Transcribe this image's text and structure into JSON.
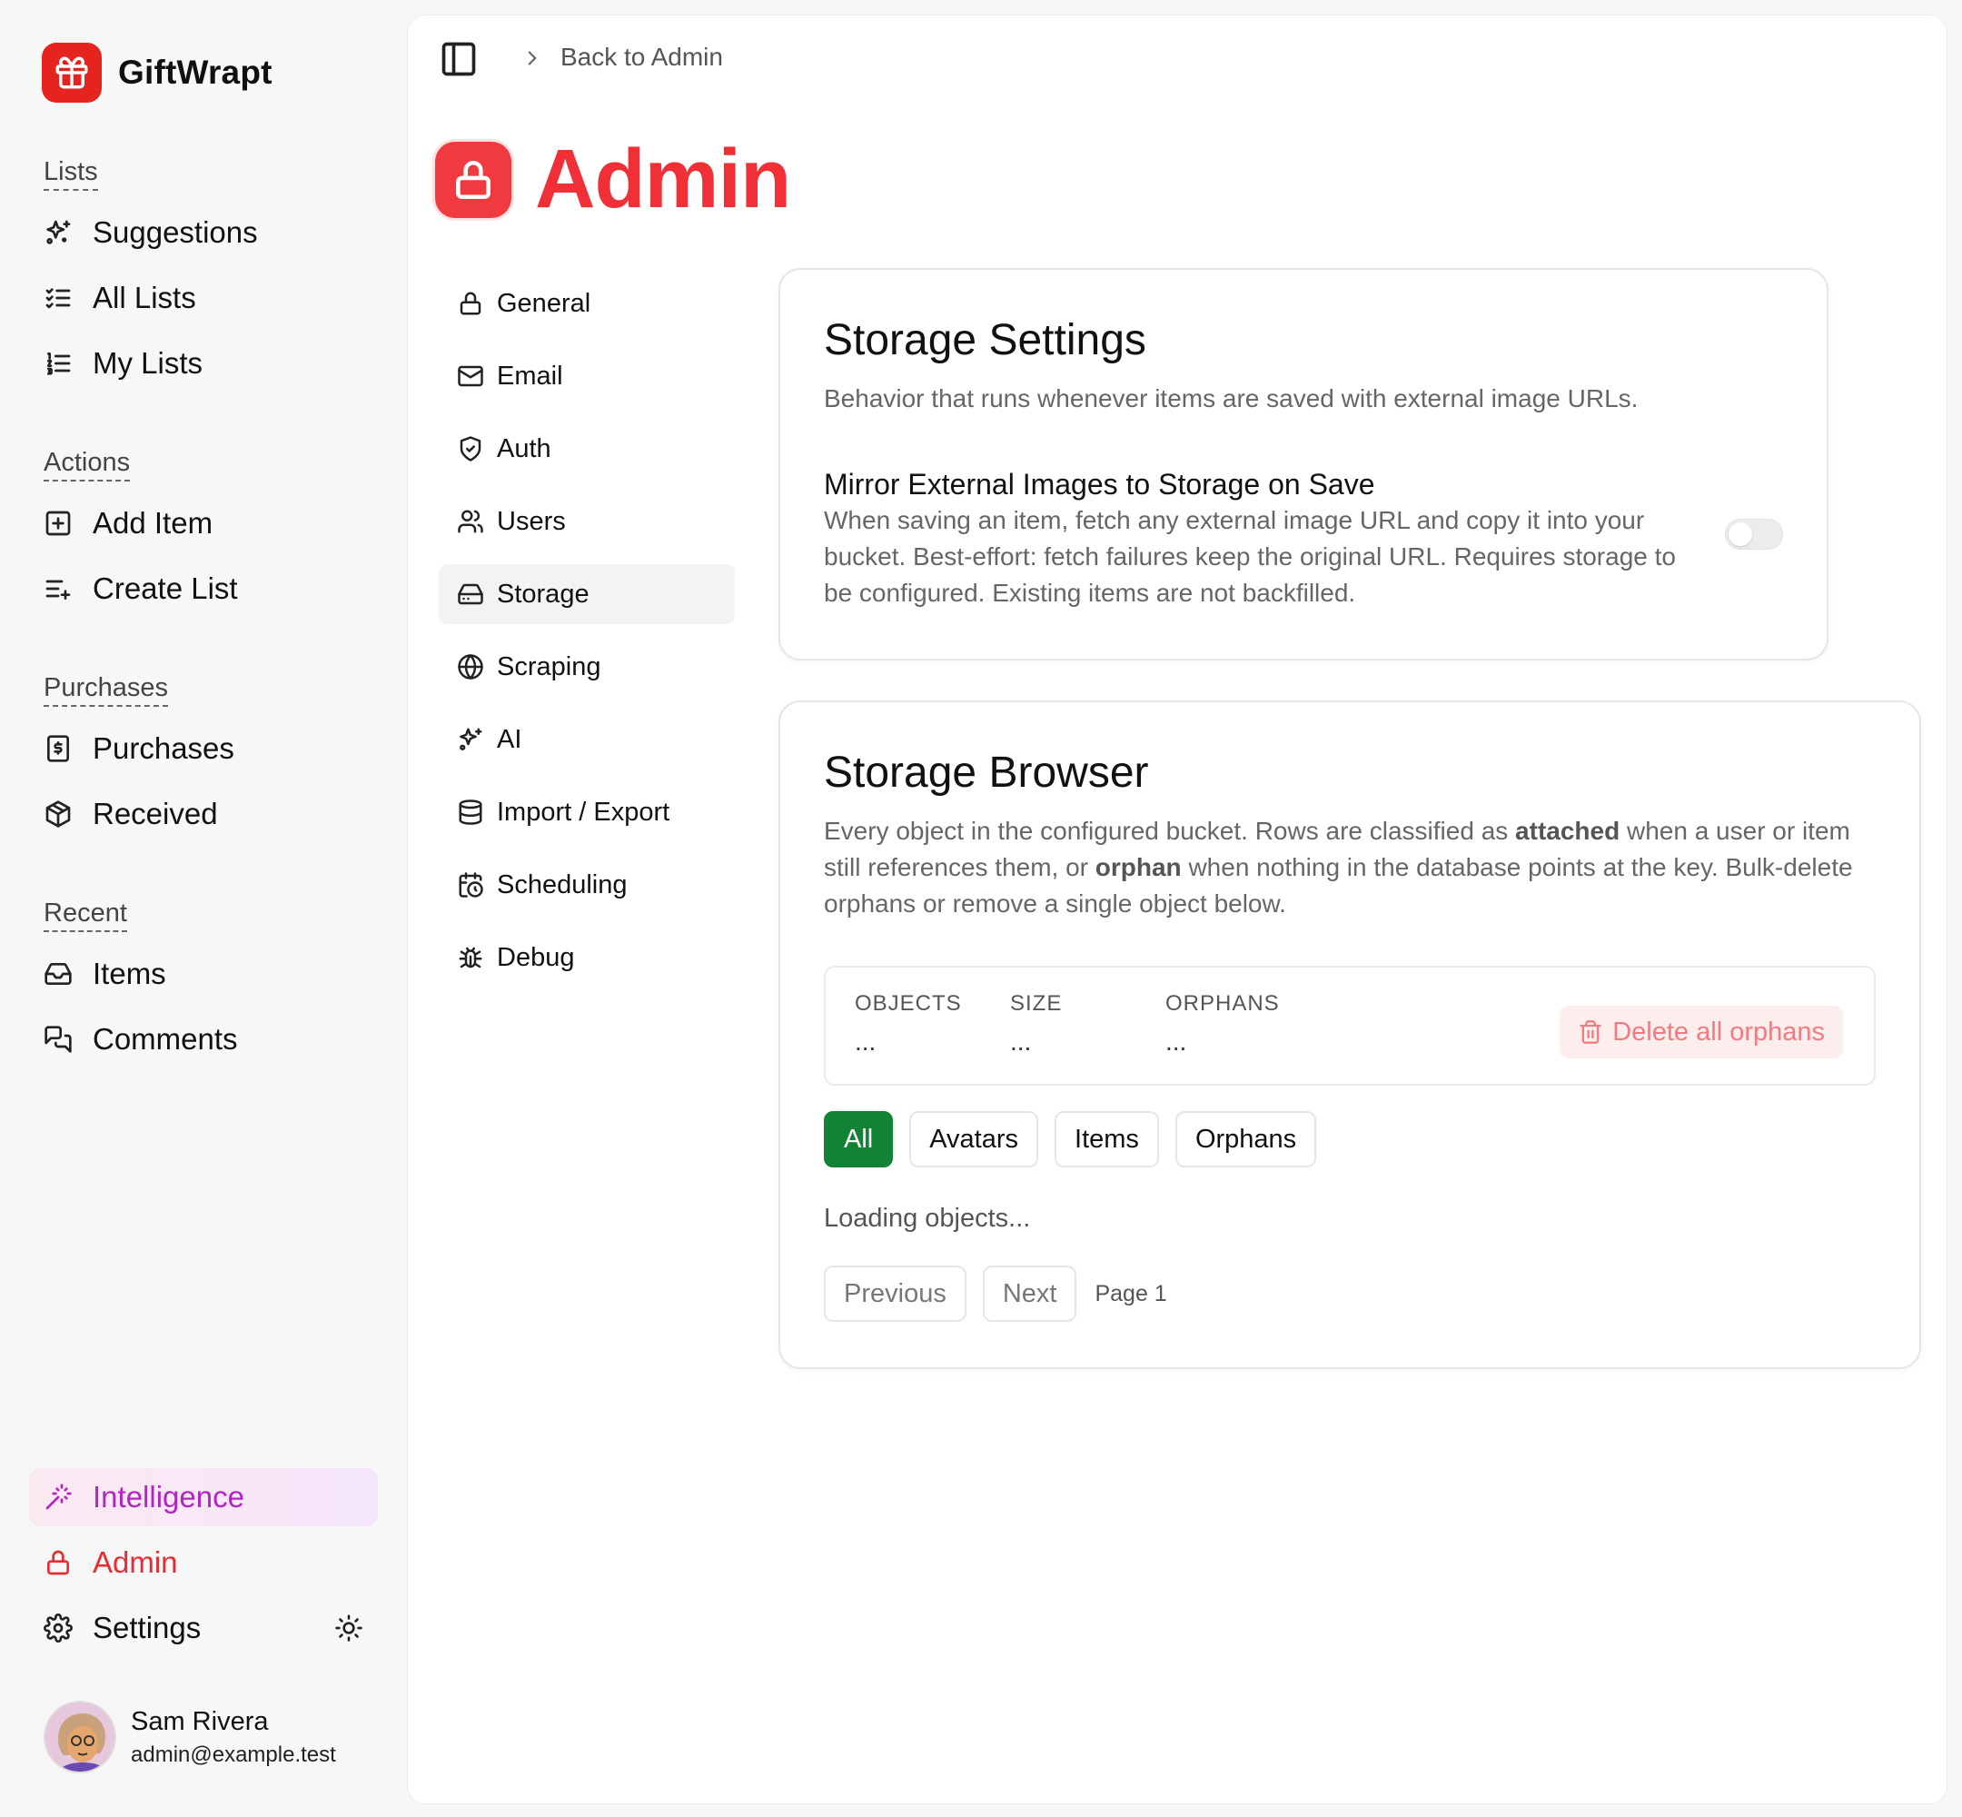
{
  "app": {
    "name": "GiftWrapt"
  },
  "sidebar": {
    "sections": {
      "lists": "Lists",
      "actions": "Actions",
      "purchases": "Purchases",
      "recent": "Recent"
    },
    "items": {
      "suggestions": "Suggestions",
      "all_lists": "All Lists",
      "my_lists": "My Lists",
      "add_item": "Add Item",
      "create_list": "Create List",
      "purchases": "Purchases",
      "received": "Received",
      "items": "Items",
      "comments": "Comments"
    },
    "bottom": {
      "intelligence": "Intelligence",
      "admin": "Admin",
      "settings": "Settings"
    },
    "user": {
      "name": "Sam Rivera",
      "email": "admin@example.test"
    }
  },
  "breadcrumb": {
    "back": "Back to Admin"
  },
  "page": {
    "title": "Admin"
  },
  "settings_nav": {
    "items": [
      "General",
      "Email",
      "Auth",
      "Users",
      "Storage",
      "Scraping",
      "AI",
      "Import / Export",
      "Scheduling",
      "Debug"
    ],
    "active": "Storage"
  },
  "storage_settings": {
    "title": "Storage Settings",
    "description": "Behavior that runs whenever items are saved with external image URLs.",
    "mirror": {
      "title": "Mirror External Images to Storage on Save",
      "description": "When saving an item, fetch any external image URL and copy it into your bucket. Best-effort: fetch failures keep the original URL. Requires storage to be configured. Existing items are not backfilled.",
      "enabled": false
    }
  },
  "storage_browser": {
    "title": "Storage Browser",
    "desc_part1": "Every object in the configured bucket. Rows are classified as ",
    "desc_bold1": "attached",
    "desc_part2": " when a user or item still references them, or ",
    "desc_bold2": "orphan",
    "desc_part3": " when nothing in the database points at the key. Bulk-delete orphans or remove a single object below.",
    "stats": {
      "objects_label": "OBJECTS",
      "objects_value": "...",
      "size_label": "SIZE",
      "size_value": "...",
      "orphans_label": "ORPHANS",
      "orphans_value": "..."
    },
    "delete_all_label": "Delete all orphans",
    "filters": [
      "All",
      "Avatars",
      "Items",
      "Orphans"
    ],
    "active_filter": "All",
    "loading_text": "Loading objects...",
    "pager": {
      "previous": "Previous",
      "next": "Next",
      "page": "Page 1"
    }
  },
  "colors": {
    "brand_red": "#e5231f",
    "admin_red": "#f12f36",
    "intelligence_purple": "#b324c5",
    "active_filter_green": "#128235"
  }
}
